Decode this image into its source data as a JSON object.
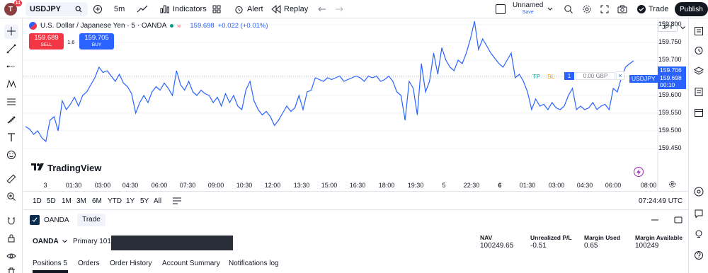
{
  "header": {
    "notification_count": "11",
    "symbol": "USDJPY",
    "interval": "5m",
    "indicators_label": "Indicators",
    "alert_label": "Alert",
    "replay_label": "Replay",
    "layout_name": "Unnamed",
    "layout_status": "Save",
    "trade_label": "Trade",
    "publish_label": "Publish"
  },
  "legend": {
    "title": "U.S. Dollar / Japanese Yen · 5 · OANDA",
    "price": "159.698",
    "change": "+0.022 (+0.01%)",
    "sell_price": "159.689",
    "sell_label": "SELL",
    "spread": "1.6",
    "buy_price": "159.705",
    "buy_label": "BUY"
  },
  "position_line": {
    "tp": "TP",
    "sl": "SL",
    "qty": "1",
    "pnl": "0.00 GBP",
    "close": "×"
  },
  "price_scale": {
    "currency": "JPY",
    "labels": [
      "159.800",
      "159.750",
      "159.700",
      "159.650",
      "159.600",
      "159.550",
      "159.500",
      "159.450"
    ],
    "badge_bid": "159.706",
    "badge_last": "159.698",
    "badge_timer": "00:10",
    "badge_symbol": "USDJPY"
  },
  "time_scale": {
    "labels": [
      "3",
      "01:30",
      "03:00",
      "04:30",
      "06:00",
      "07:30",
      "09:00",
      "10:30",
      "12:00",
      "13:30",
      "15:00",
      "16:30",
      "18:00",
      "19:30",
      "5",
      "22:30",
      "6",
      "01:30",
      "03:00",
      "04:30",
      "06:00",
      "08:00"
    ]
  },
  "watermark": "TradingView",
  "timeframes": [
    "1D",
    "5D",
    "1M",
    "3M",
    "6M",
    "YTD",
    "1Y",
    "5Y",
    "All"
  ],
  "clock": "07:24:49 UTC",
  "panel": {
    "broker_tab": "OANDA",
    "trade_tab": "Trade",
    "account_broker": "OANDA",
    "account_name": "Primary 101-",
    "nav_label": "NAV",
    "nav_value": "100249.65",
    "upl_label": "Unrealized P/L",
    "upl_value": "-0.51",
    "margin_used_label": "Margin Used",
    "margin_used_value": "0.65",
    "margin_avail_label": "Margin Available",
    "margin_avail_value": "100249",
    "tabs": [
      "Positions 5",
      "Orders",
      "Order History",
      "Account Summary",
      "Notifications log"
    ]
  },
  "colors": {
    "line": "#2962ff",
    "sell": "#f23645",
    "buy": "#2962ff",
    "tp": "#26a69a",
    "sl": "#ff9800",
    "purple": "#9c27b0"
  },
  "chart_data": {
    "type": "line",
    "title": "U.S. Dollar / Japanese Yen · 5 · OANDA",
    "ylim": [
      159.43,
      159.84
    ],
    "y_ticks": [
      159.45,
      159.5,
      159.55,
      159.6,
      159.65,
      159.7,
      159.75,
      159.8
    ],
    "x_tick_labels": [
      "3",
      "01:30",
      "03:00",
      "04:30",
      "06:00",
      "07:30",
      "09:00",
      "10:30",
      "12:00",
      "13:30",
      "15:00",
      "16:30",
      "18:00",
      "19:30",
      "5",
      "22:30",
      "6",
      "01:30",
      "03:00",
      "04:30",
      "06:00",
      "08:00"
    ],
    "series": [
      {
        "values": [
          159.512,
          159.505,
          159.49,
          159.5,
          159.48,
          159.47,
          159.53,
          159.54,
          159.5,
          159.585,
          159.56,
          159.575,
          159.595,
          159.57,
          159.6,
          159.61,
          159.63,
          159.65,
          159.68,
          159.665,
          159.67,
          159.655,
          159.64,
          159.66,
          159.635,
          159.625,
          159.605,
          159.55,
          159.58,
          159.6,
          159.58,
          159.61,
          159.625,
          159.615,
          159.635,
          159.62,
          159.6,
          159.67,
          159.63,
          159.615,
          159.64,
          159.61,
          159.6,
          159.615,
          159.605,
          159.6,
          159.58,
          159.595,
          159.57,
          159.605,
          159.58,
          159.6,
          159.57,
          159.56,
          159.615,
          159.64,
          159.585,
          159.56,
          159.545,
          159.555,
          159.54,
          159.515,
          159.53,
          159.55,
          159.57,
          159.555,
          159.565,
          159.6,
          159.56,
          159.61,
          159.615,
          159.65,
          159.645,
          159.64,
          159.65,
          159.645,
          159.65,
          159.655,
          159.64,
          159.645,
          159.65,
          159.655,
          159.65,
          159.64,
          159.655,
          159.65,
          159.655,
          159.64,
          159.645,
          159.655,
          159.64,
          159.61,
          159.6,
          159.53,
          159.64,
          159.62,
          159.545,
          159.69,
          159.61,
          159.64,
          159.72,
          159.66,
          159.735,
          159.7,
          159.68,
          159.67,
          159.7,
          159.69,
          159.72,
          159.76,
          159.81,
          159.73,
          159.76,
          159.74,
          159.72,
          159.705,
          159.69,
          159.68,
          159.7,
          159.72,
          159.65,
          159.66,
          159.64,
          159.61,
          159.56,
          159.59,
          159.57,
          159.575,
          159.56,
          159.58,
          159.565,
          159.56,
          159.57,
          159.6,
          159.62,
          159.56,
          159.57,
          159.56,
          159.565,
          159.58,
          159.56,
          159.57,
          159.575,
          159.56,
          159.62,
          159.61,
          159.65,
          159.68,
          159.69,
          159.698
        ]
      }
    ]
  }
}
